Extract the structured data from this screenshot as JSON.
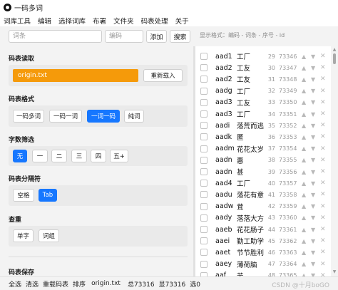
{
  "window": {
    "title": "一码多词"
  },
  "menu": [
    "词库工具",
    "编辑",
    "选择词库",
    "布署",
    "文件夹",
    "码表处理",
    "关于"
  ],
  "toolbar": {
    "word_placeholder": "词条",
    "code_placeholder": "编码",
    "add_label": "添加",
    "search_label": "搜索",
    "format_hint": "显示格式：编码 - 词条 - 序号 - id"
  },
  "sections": {
    "read": {
      "title": "码表读取",
      "file": "origin.txt",
      "reload_label": "重新载入"
    },
    "format": {
      "title": "码表格式",
      "options": [
        "一码多词",
        "一码一词",
        "一词一码",
        "纯词"
      ],
      "selected": "一词一码"
    },
    "count_filter": {
      "title": "字数筛选",
      "options": [
        "无",
        "一",
        "二",
        "三",
        "四",
        "五+"
      ],
      "selected": "无"
    },
    "separator": {
      "title": "码表分隔符",
      "options": [
        "空格",
        "Tab"
      ],
      "selected": "Tab"
    },
    "dedupe": {
      "title": "查重",
      "options": [
        "单字",
        "词组"
      ]
    },
    "save": {
      "title": "码表保存"
    }
  },
  "entries": [
    {
      "code": "aad1",
      "word": "工厂",
      "rank": "29",
      "seq": "73346"
    },
    {
      "code": "aad2",
      "word": "工友",
      "rank": "30",
      "seq": "73347"
    },
    {
      "code": "aad2",
      "word": "工友",
      "rank": "31",
      "seq": "73348"
    },
    {
      "code": "aadg",
      "word": "工厂",
      "rank": "32",
      "seq": "73349"
    },
    {
      "code": "aad3",
      "word": "工友",
      "rank": "33",
      "seq": "73350"
    },
    {
      "code": "aad3",
      "word": "工厂",
      "rank": "34",
      "seq": "73351"
    },
    {
      "code": "aadi",
      "word": "落荒而逃",
      "rank": "35",
      "seq": "73352"
    },
    {
      "code": "aadk",
      "word": "匿",
      "rank": "36",
      "seq": "73353"
    },
    {
      "code": "aadm",
      "word": "花花太岁",
      "rank": "37",
      "seq": "73354"
    },
    {
      "code": "aadn",
      "word": "惠",
      "rank": "38",
      "seq": "73355"
    },
    {
      "code": "aadn",
      "word": "甚",
      "rank": "39",
      "seq": "73356"
    },
    {
      "code": "aad4",
      "word": "工厂",
      "rank": "40",
      "seq": "73357"
    },
    {
      "code": "aadu",
      "word": "落花有意",
      "rank": "41",
      "seq": "73358"
    },
    {
      "code": "aadw",
      "word": "茸",
      "rank": "42",
      "seq": "73359"
    },
    {
      "code": "aady",
      "word": "落落大方",
      "rank": "43",
      "seq": "73360"
    },
    {
      "code": "aaeb",
      "word": "花花肠子",
      "rank": "44",
      "seq": "73361"
    },
    {
      "code": "aaei",
      "word": "勤工助学",
      "rank": "45",
      "seq": "73362"
    },
    {
      "code": "aaet",
      "word": "节节胜利",
      "rank": "46",
      "seq": "73363"
    },
    {
      "code": "aaey",
      "word": "薄荷脑",
      "rank": "47",
      "seq": "73364"
    },
    {
      "code": "aaf",
      "word": "苦",
      "rank": "48",
      "seq": "73365"
    }
  ],
  "status": {
    "select_all": "全选",
    "clear": "清选",
    "reload_table": "重载码表",
    "sort": "排序",
    "file": "origin.txt",
    "total": "总73316",
    "shown": "显73316",
    "selected": "选0"
  },
  "watermark": "CSDN @十月boGO"
}
